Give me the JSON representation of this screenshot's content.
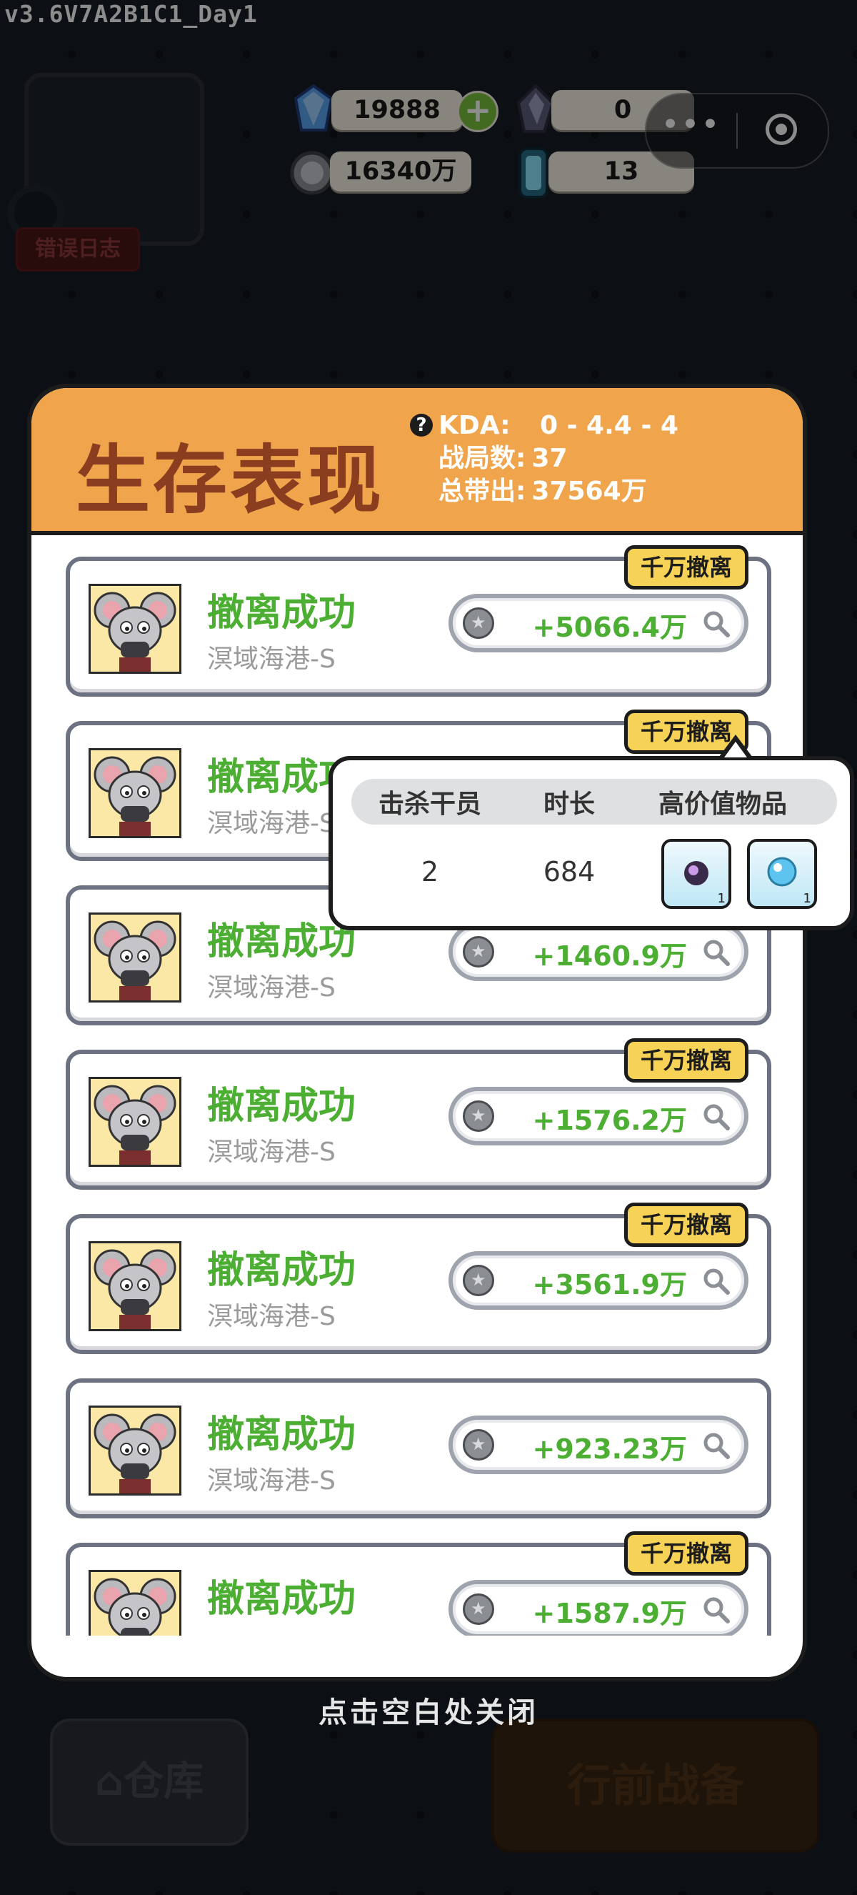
{
  "version": "v3.6V7A2B1C1_Day1",
  "error_log_label": "错误日志",
  "currency": {
    "diamond": "19888",
    "crystal": "0",
    "coins": "16340万",
    "energy": "13"
  },
  "capsule": {
    "more": "•••"
  },
  "panel": {
    "title": "生存表现",
    "help_icon": "?",
    "stats": [
      {
        "key": "KDA:",
        "value": "0 - 4.4 - 4"
      },
      {
        "key": "战局数:",
        "value": "37"
      },
      {
        "key": "总带出:",
        "value": "37564万"
      }
    ]
  },
  "records": [
    {
      "status": "撤离成功",
      "map": "溟域海港-S",
      "value": "+5066.4万",
      "badge": "千万撤离"
    },
    {
      "status": "撤离成功",
      "map": "溟域海港-S",
      "value": "",
      "badge": "千万撤离"
    },
    {
      "status": "撤离成功",
      "map": "溟域海港-S",
      "value": "+1460.9万",
      "badge": ""
    },
    {
      "status": "撤离成功",
      "map": "溟域海港-S",
      "value": "+1576.2万",
      "badge": "千万撤离"
    },
    {
      "status": "撤离成功",
      "map": "溟域海港-S",
      "value": "+3561.9万",
      "badge": "千万撤离"
    },
    {
      "status": "撤离成功",
      "map": "溟域海港-S",
      "value": "+923.23万",
      "badge": ""
    },
    {
      "status": "撤离成功",
      "map": "",
      "value": "+1587.9万",
      "badge": "千万撤离"
    }
  ],
  "popover": {
    "headers": [
      "击杀干员",
      "时长",
      "高价值物品"
    ],
    "kills": "2",
    "duration": "684",
    "items": [
      {
        "icon": "purple-gem-icon",
        "count": "1"
      },
      {
        "icon": "crystal-orb-icon",
        "count": "1"
      }
    ]
  },
  "close_hint": "点击空白处关闭",
  "bottom_buttons": {
    "warehouse": "仓库",
    "prepare": "行前战备"
  },
  "colors": {
    "header_orange": "#f0a54d",
    "title_brown": "#8a3d1f",
    "success_green": "#4cae32",
    "badge_yellow": "#f6d257"
  }
}
